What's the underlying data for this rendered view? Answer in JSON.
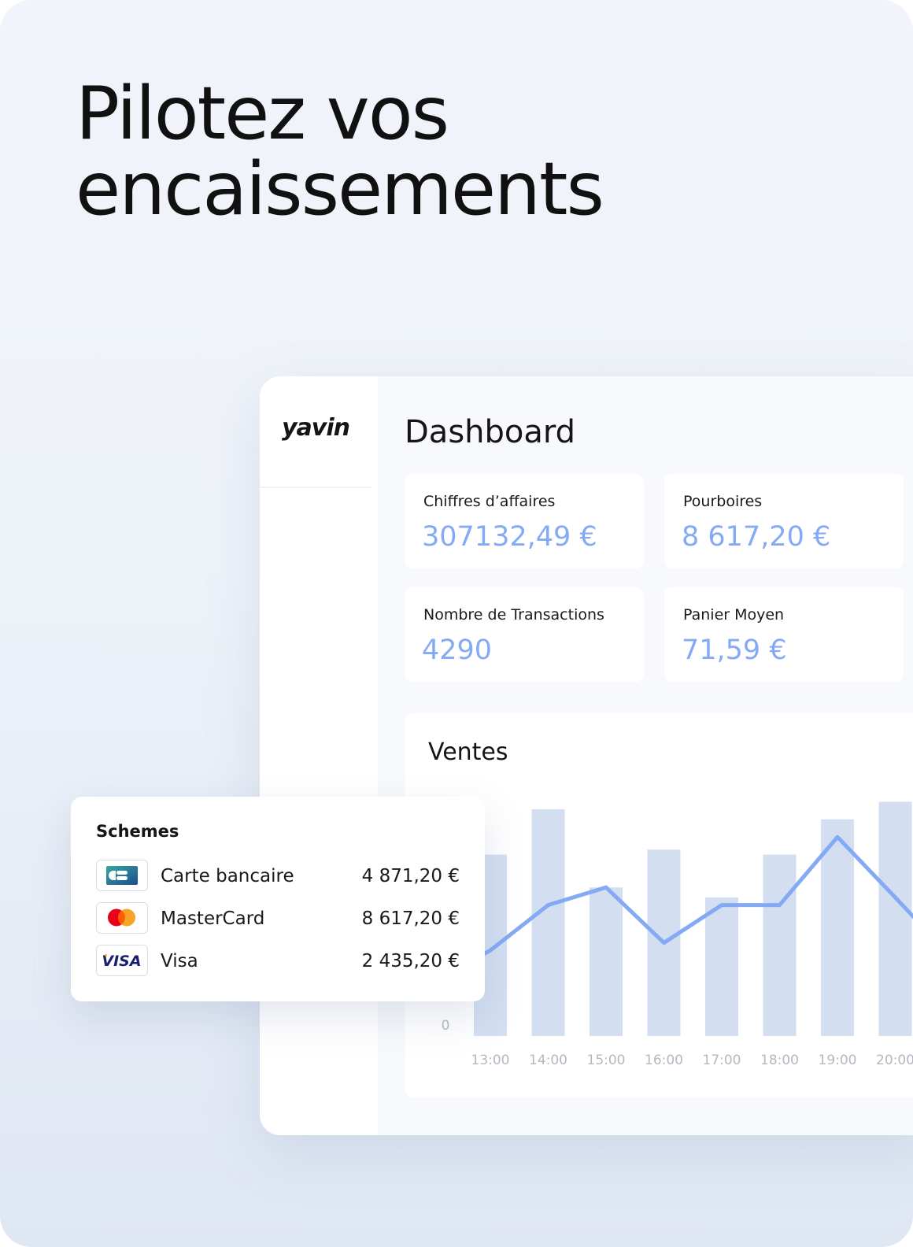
{
  "headline": {
    "line1": "Pilotez vos",
    "line2": "encaissements"
  },
  "app": {
    "logo": "yavin",
    "title": "Dashboard"
  },
  "stats": [
    {
      "label": "Chiffres d’affaires",
      "value": "307132,49 €"
    },
    {
      "label": "Pourboires",
      "value": "8 617,20 €"
    },
    {
      "label": "Nombre de Transactions",
      "value": "4290"
    },
    {
      "label": "Panier Moyen",
      "value": "71,59 €"
    }
  ],
  "colors": {
    "accent": "#84aaf5",
    "bar": "#d3dff1",
    "line": "#84aaf5",
    "axis_text": "#b3b8c2"
  },
  "chart_data": {
    "type": "bar",
    "title": "Ventes",
    "categories": [
      "13:00",
      "14:00",
      "15:00",
      "16:00",
      "17:00",
      "18:00",
      "19:00",
      "20:00"
    ],
    "y_zero_label": "0",
    "series": [
      {
        "type": "bar",
        "values": [
          72,
          90,
          59,
          74,
          55,
          72,
          86,
          93
        ]
      },
      {
        "type": "line",
        "values": [
          34,
          52,
          59,
          37,
          52,
          52,
          79,
          55
        ]
      }
    ],
    "ylim": [
      0,
      100
    ],
    "grid": false
  },
  "schemes": {
    "title": "Schemes",
    "items": [
      {
        "icon": "cb-card-icon",
        "name": "Carte bancaire",
        "amount": "4 871,20 €"
      },
      {
        "icon": "mastercard-icon",
        "name": "MasterCard",
        "amount": "8 617,20 €"
      },
      {
        "icon": "visa-icon",
        "name": "Visa",
        "amount": "2 435,20 €",
        "icon_text": "VISA"
      }
    ]
  }
}
